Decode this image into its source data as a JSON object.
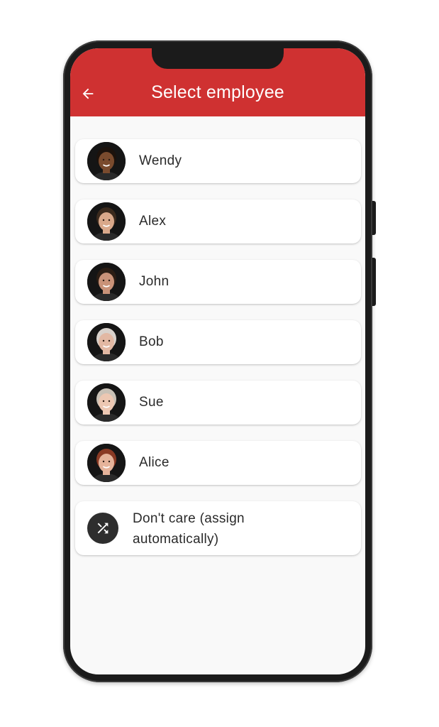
{
  "app_bar": {
    "title": "Select employee",
    "back_icon": "arrow-left-icon",
    "background_color": "#cf3131"
  },
  "employees": [
    {
      "name": "Wendy",
      "skin": "#7a4b2e",
      "hair": "#1c120c"
    },
    {
      "name": "Alex",
      "skin": "#d9a88a",
      "hair": "#3b2a1d"
    },
    {
      "name": "John",
      "skin": "#c99278",
      "hair": "#2b1d14"
    },
    {
      "name": "Bob",
      "skin": "#e2b8a3",
      "hair": "#d9d2cc"
    },
    {
      "name": "Sue",
      "skin": "#ecc7b2",
      "hair": "#c9c1b6"
    },
    {
      "name": "Alice",
      "skin": "#e5b39a",
      "hair": "#8a3a24"
    }
  ],
  "auto_assign": {
    "label": "Don't care (assign automatically)",
    "icon": "shuffle-icon"
  }
}
